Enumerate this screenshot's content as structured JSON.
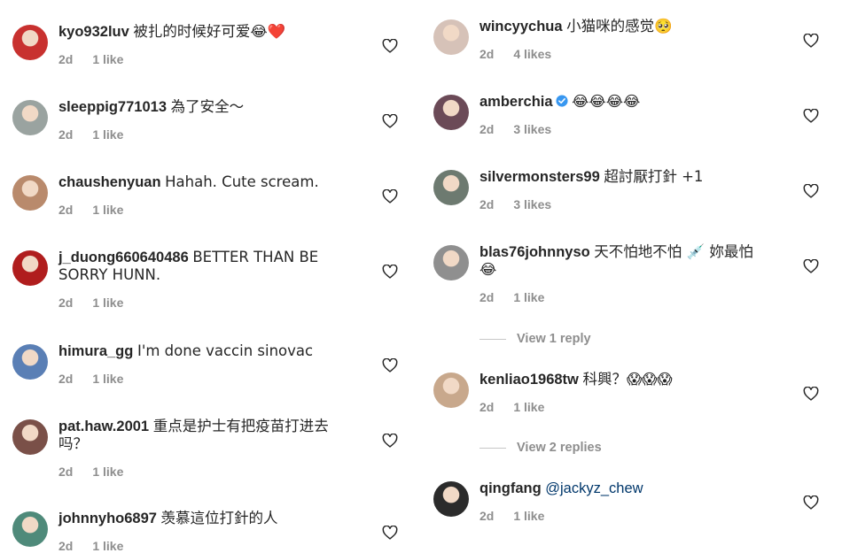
{
  "left": [
    {
      "user": "kyo932luv",
      "text": "被扎的时候好可爱😂❤️",
      "time": "2d",
      "likes": "1 like",
      "avatar_color": "#c8312f"
    },
    {
      "user": "sleeppig771013",
      "text": "為了安全～",
      "time": "2d",
      "likes": "1 like",
      "avatar_color": "#9aa3a0"
    },
    {
      "user": "chaushenyuan",
      "text": "Hahah. Cute scream.",
      "time": "2d",
      "likes": "1 like",
      "avatar_color": "#b98a6c"
    },
    {
      "user": "j_duong660640486",
      "text": "BETTER THAN BE",
      "text2": "SORRY HUNN.",
      "time": "2d",
      "likes": "1 like",
      "avatar_color": "#b01d1d"
    },
    {
      "user": "himura_gg",
      "text": "I'm done vaccin sinovac",
      "time": "2d",
      "likes": "1 like",
      "avatar_color": "#5a7fb5"
    },
    {
      "user": "pat.haw.2001",
      "text": "重点是护士有把疫苗打进去",
      "text2": "吗？",
      "time": "2d",
      "likes": "1 like",
      "avatar_color": "#7a5048"
    },
    {
      "user": "johnnyho6897",
      "text": "羡慕這位打針的人",
      "time": "2d",
      "likes": "1 like",
      "avatar_color": "#4f8a7a"
    }
  ],
  "right": [
    {
      "user": "wincyychua",
      "text": "小猫咪的感觉🥺",
      "time": "2d",
      "likes": "4 likes",
      "avatar_color": "#d6c2b8"
    },
    {
      "user": "amberchia",
      "text": "😂😂😂😂",
      "time": "2d",
      "likes": "3 likes",
      "avatar_color": "#6b4a57",
      "verified": true
    },
    {
      "user": "silvermonsters99",
      "text": "超討厭打針 +1",
      "time": "2d",
      "likes": "3 likes",
      "avatar_color": "#6d7a70"
    },
    {
      "user": "blas76johnnyso",
      "text": "天不怕地不怕 💉 妳最怕",
      "text2": "😂",
      "time": "2d",
      "likes": "1 like",
      "avatar_color": "#8f8f8f"
    },
    {
      "replies": "View 1 reply"
    },
    {
      "user": "kenliao1968tw",
      "text": "科興？😱😱😱",
      "time": "2d",
      "likes": "1 like",
      "avatar_color": "#c8a88c"
    },
    {
      "replies": "View 2 replies"
    },
    {
      "user": "qingfang",
      "mention": "@jackyz_chew",
      "time": "2d",
      "likes": "1 like",
      "avatar_color": "#2b2b2b"
    }
  ],
  "colors": {
    "mention": "#00376b",
    "meta": "#8e8e8e",
    "verified": "#3897f0"
  },
  "icons": {
    "like": "heart-outline-icon",
    "verified": "verified-badge-icon"
  }
}
